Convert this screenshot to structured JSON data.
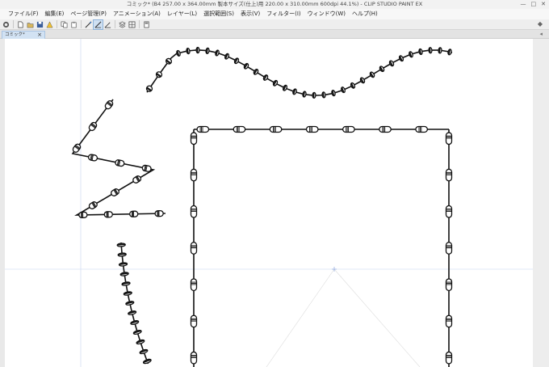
{
  "window": {
    "title": "コミック* (B4 257.00 x 364.00mm 製本サイズ(仕上)用 220.00 x 310.00mm 600dpi 44.1%) - CLIP STUDIO PAINT EX",
    "controls": [
      "—",
      "□",
      "✕"
    ]
  },
  "menu": {
    "items": [
      "ファイル(F)",
      "編集(E)",
      "ページ管理(P)",
      "アニメーション(A)",
      "レイヤー(L)",
      "選択範囲(S)",
      "表示(V)",
      "フィルター(I)",
      "ウィンドウ(W)",
      "ヘルプ(H)"
    ]
  },
  "toolbar": {
    "icons": [
      "app-icon",
      "new-icon",
      "open-icon",
      "save-icon",
      "warning-icon",
      "copy-icon",
      "paste-icon",
      "ruler-icon",
      "snap-ruler-icon",
      "snap-grid-icon",
      "layer-icon",
      "frame-icon",
      "page-icon"
    ],
    "active_index": 9,
    "right_mark": "◆"
  },
  "document_tab": {
    "label": "コミック*",
    "close": "×",
    "pin": "◂"
  },
  "colors": {
    "ink": "#111111",
    "guide": "#c6d3f0"
  }
}
